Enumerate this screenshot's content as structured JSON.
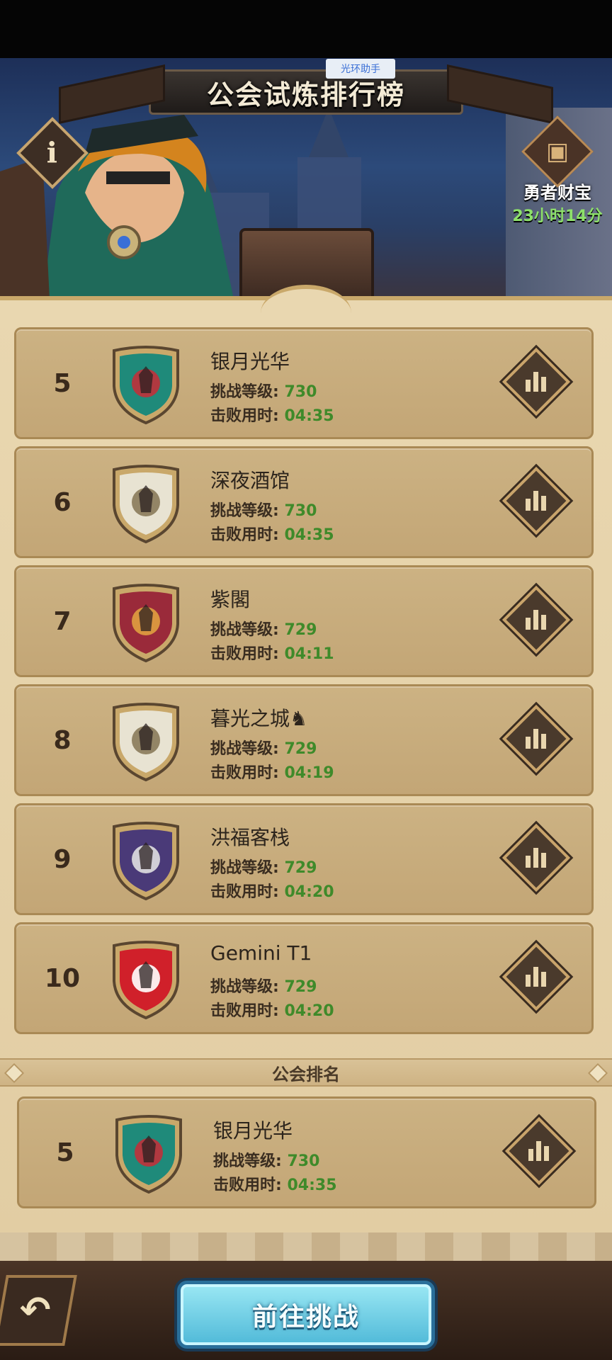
{
  "helper_tag": "光环助手",
  "header": {
    "title": "公会试炼排行榜"
  },
  "info_button": "i",
  "treasure": {
    "label": "勇者财宝",
    "timer": "23小时14分"
  },
  "stat_labels": {
    "level": "挑战等级:",
    "time": "击败用时:"
  },
  "rankings": [
    {
      "rank": "5",
      "name": "银月光华",
      "level": "730",
      "time": "04:35",
      "crest_color": "#1f8a7a",
      "crest_accent": "#c0303a"
    },
    {
      "rank": "6",
      "name": "深夜酒馆",
      "level": "730",
      "time": "04:35",
      "crest_color": "#e8e3d2",
      "crest_accent": "#8a7a5a"
    },
    {
      "rank": "7",
      "name": "紫閣",
      "level": "729",
      "time": "04:11",
      "crest_color": "#9a2a3a",
      "crest_accent": "#e0a040"
    },
    {
      "rank": "8",
      "name": "暮光之城♞",
      "level": "729",
      "time": "04:19",
      "crest_color": "#e8e3d2",
      "crest_accent": "#8a7a5a"
    },
    {
      "rank": "9",
      "name": "洪福客栈",
      "level": "729",
      "time": "04:20",
      "crest_color": "#4a3a78",
      "crest_accent": "#e0e0e0"
    },
    {
      "rank": "10",
      "name": "Gemini T1",
      "level": "729",
      "time": "04:20",
      "crest_color": "#d0202a",
      "crest_accent": "#ffffff"
    }
  ],
  "section_label": "公会排名",
  "my_guild": {
    "rank": "5",
    "name": "银月光华",
    "level": "730",
    "time": "04:35",
    "crest_color": "#1f8a7a",
    "crest_accent": "#c0303a"
  },
  "footer": {
    "go_button": "前往挑战",
    "back_icon": "↶"
  }
}
